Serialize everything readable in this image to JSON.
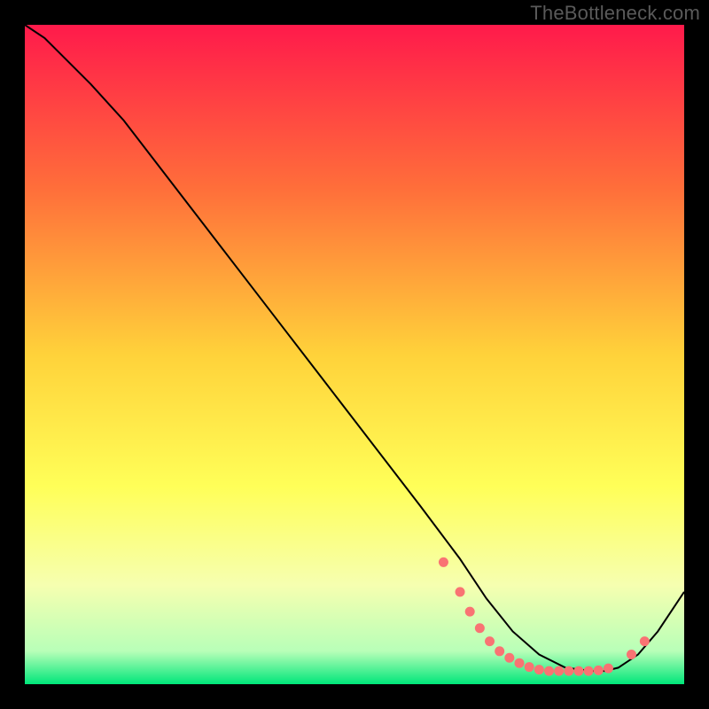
{
  "watermark": "TheBottleneck.com",
  "chart_data": {
    "type": "line",
    "title": "",
    "xlabel": "",
    "ylabel": "",
    "xlim": [
      0,
      100
    ],
    "ylim": [
      0,
      100
    ],
    "background_gradient": {
      "stops": [
        {
          "offset": 0,
          "color": "#ff1a4b"
        },
        {
          "offset": 25,
          "color": "#ff6f3a"
        },
        {
          "offset": 50,
          "color": "#ffd23a"
        },
        {
          "offset": 70,
          "color": "#ffff58"
        },
        {
          "offset": 85,
          "color": "#f6ffb0"
        },
        {
          "offset": 95,
          "color": "#b8ffb8"
        },
        {
          "offset": 100,
          "color": "#00e67a"
        }
      ]
    },
    "series": [
      {
        "name": "curve",
        "color": "#000000",
        "width": 2,
        "x": [
          0,
          3,
          6,
          10,
          15,
          20,
          25,
          30,
          35,
          40,
          45,
          50,
          55,
          60,
          63,
          66,
          70,
          74,
          78,
          82,
          86,
          88,
          90,
          93,
          96,
          100
        ],
        "y": [
          100,
          98,
          95,
          91,
          85.5,
          79,
          72.5,
          66,
          59.5,
          53,
          46.5,
          40,
          33.5,
          27,
          23,
          19,
          13,
          8,
          4.5,
          2.5,
          2,
          2,
          2.5,
          4.5,
          8,
          14
        ]
      }
    ],
    "markers": {
      "color": "#f97373",
      "radius": 5.5,
      "points": [
        {
          "x": 63.5,
          "y": 18.5
        },
        {
          "x": 66.0,
          "y": 14.0
        },
        {
          "x": 67.5,
          "y": 11.0
        },
        {
          "x": 69.0,
          "y": 8.5
        },
        {
          "x": 70.5,
          "y": 6.5
        },
        {
          "x": 72.0,
          "y": 5.0
        },
        {
          "x": 73.5,
          "y": 4.0
        },
        {
          "x": 75.0,
          "y": 3.2
        },
        {
          "x": 76.5,
          "y": 2.6
        },
        {
          "x": 78.0,
          "y": 2.2
        },
        {
          "x": 79.5,
          "y": 2.0
        },
        {
          "x": 81.0,
          "y": 2.0
        },
        {
          "x": 82.5,
          "y": 2.0
        },
        {
          "x": 84.0,
          "y": 2.0
        },
        {
          "x": 85.5,
          "y": 2.0
        },
        {
          "x": 87.0,
          "y": 2.1
        },
        {
          "x": 88.5,
          "y": 2.4
        },
        {
          "x": 92.0,
          "y": 4.5
        },
        {
          "x": 94.0,
          "y": 6.5
        }
      ]
    }
  }
}
